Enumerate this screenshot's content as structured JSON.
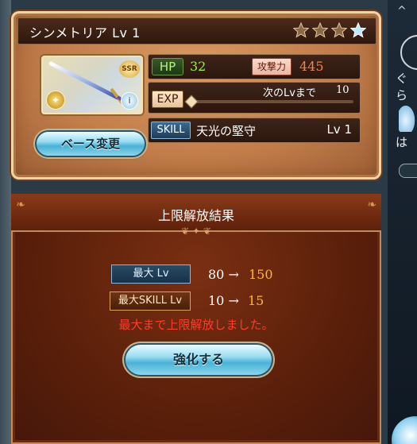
{
  "item_card": {
    "title": "シンメトリア Lv 1",
    "stars_total": 4,
    "stars_filled": 3,
    "rarity_badge": "SSR",
    "hp_label": "HP",
    "hp_value": "32",
    "atk_label": "攻撃力",
    "atk_value": "445",
    "exp_label": "EXP",
    "exp_next_label": "次のLvまで",
    "exp_next_value": "10",
    "exp_progress": 0.02,
    "skill_label": "SKILL",
    "skill_name": "天光の堅守",
    "skill_level": "Lv 1",
    "base_change_button": "ベース変更"
  },
  "result_panel": {
    "title": "上限解放結果",
    "max_lv_label": "最大 Lv",
    "max_lv_from": "80 →",
    "max_lv_to": "150",
    "max_skill_label": "最大SKILL Lv",
    "max_skill_from": "10 →",
    "max_skill_to": "15",
    "message": "最大まで上限解放しました。",
    "enhance_button": "強化する"
  },
  "side_panel": {
    "text_top": "ぐら",
    "text_mid": "は"
  },
  "colors": {
    "panel_brown": "#5a1f0a",
    "card_orange": "#c27d4a",
    "hp_green": "#9df04a",
    "atk_orange": "#ff7e45",
    "upgrade_value": "#ffb43c",
    "message_red": "#ff3c2a"
  }
}
